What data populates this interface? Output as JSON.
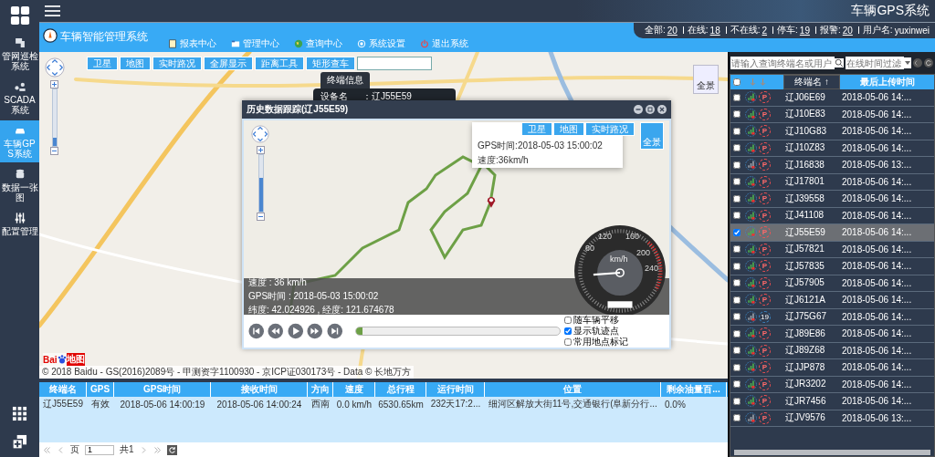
{
  "top_bar": {
    "title": "车辆GPS系统"
  },
  "sidebar": {
    "items": [
      {
        "label": "管网巡检系统",
        "selected": false
      },
      {
        "label": "SCADA系统",
        "selected": false
      },
      {
        "label": "车辆GPS系统",
        "selected": true
      },
      {
        "label": "数据一张图",
        "selected": false
      },
      {
        "label": "配置管理",
        "selected": false
      }
    ]
  },
  "header": {
    "title": "车辆智能管理系统",
    "nav": [
      "报表中心",
      "管理中心",
      "查询中心",
      "系统设置",
      "退出系统"
    ],
    "stats": [
      {
        "label": "全部:",
        "value": "20"
      },
      {
        "label": "在线:",
        "value": "18"
      },
      {
        "label": "不在线:",
        "value": "2"
      },
      {
        "label": "停车:",
        "value": "19"
      },
      {
        "label": "报警:",
        "value": "20"
      }
    ],
    "user_label": "用户名:",
    "user": "yuxinwei"
  },
  "map": {
    "toolbar": [
      "卫星",
      "地图",
      "实时路况",
      "全屏显示",
      "距离工具",
      "矩形查车"
    ],
    "panorama": "全景",
    "zoom": {
      "level": 0.15
    },
    "info_popup": {
      "tab": "终端信息",
      "label": "设备名",
      "value": "：辽J55E59"
    },
    "logo": {
      "left": "Bai",
      "right": "地图"
    },
    "attribution": "© 2018 Baidu - GS(2016)2089号 - 甲测资字1100930 - 京ICP证030173号 - Data © 长地万方"
  },
  "dialog": {
    "title": "历史数据跟踪(辽J55E59)",
    "map_buttons": [
      "卫星",
      "地图",
      "实时路况"
    ],
    "panorama": "全景",
    "zoom": {
      "level": 0.6
    },
    "popup": [
      "GPS时间:2018-05-03 15:00:02",
      "速度:36km/h"
    ],
    "readout": [
      "速度 : 36 km/h",
      "GPS时间 : 2018-05-03 15:00:02",
      "纬度: 42.024926 , 经度: 121.674678"
    ],
    "gauge": {
      "unit": "km/h",
      "ticks": [
        "80",
        "120",
        "160",
        "200",
        "240"
      ]
    },
    "progress": {
      "level": 0.03
    },
    "options": [
      {
        "label": "随车辆平移",
        "checked": false
      },
      {
        "label": "显示轨迹点",
        "checked": true
      },
      {
        "label": "常用地点标记",
        "checked": false
      }
    ]
  },
  "table": {
    "columns": [
      "终端名",
      "GPS",
      "GPS时间",
      "接收时间",
      "方向",
      "速度",
      "总行程",
      "运行时间",
      "位置",
      "剩余油量百..."
    ],
    "rows": [
      [
        "辽J55E59",
        "有效",
        "2018-05-06 14:00:19",
        "2018-05-06 14:00:24",
        "西南",
        "0.0 km/h",
        "6530.65km",
        "232天17:2...",
        "细河区解放大街11号,交通银行(阜新分行...",
        "0.0%"
      ]
    ],
    "pager": {
      "page_label": "页",
      "page": "1",
      "total": "共1"
    }
  },
  "vehicles": {
    "search_placeholder": "请输入查询终端名或用户",
    "filter_placeholder": "在线时间过滤",
    "all_selected": false,
    "columns": [
      "终端名 ↑",
      "最后上传时间"
    ],
    "rows": [
      {
        "name": "辽J06E69",
        "time": "2018-05-06 14:...",
        "online": true,
        "badge": "P",
        "selected": false
      },
      {
        "name": "辽J10E83",
        "time": "2018-05-06 14:...",
        "online": true,
        "badge": "P",
        "selected": false
      },
      {
        "name": "辽J10G83",
        "time": "2018-05-06 14:...",
        "online": true,
        "badge": "P",
        "selected": false
      },
      {
        "name": "辽J10Z83",
        "time": "2018-05-06 14:...",
        "online": true,
        "badge": "P",
        "selected": false
      },
      {
        "name": "辽J16838",
        "time": "2018-05-06 13:...",
        "online": false,
        "badge": "P",
        "selected": false
      },
      {
        "name": "辽J17801",
        "time": "2018-05-06 14:...",
        "online": true,
        "badge": "P",
        "selected": false
      },
      {
        "name": "辽J39558",
        "time": "2018-05-06 14:...",
        "online": true,
        "badge": "P",
        "selected": false
      },
      {
        "name": "辽J41108",
        "time": "2018-05-06 14:...",
        "online": true,
        "badge": "P",
        "selected": false
      },
      {
        "name": "辽J55E59",
        "time": "2018-05-06 14:...",
        "online": true,
        "badge": "P",
        "selected": true
      },
      {
        "name": "辽J57821",
        "time": "2018-05-06 14:...",
        "online": true,
        "badge": "P",
        "selected": false
      },
      {
        "name": "辽J57835",
        "time": "2018-05-06 14:...",
        "online": true,
        "badge": "P",
        "selected": false
      },
      {
        "name": "辽J57905",
        "time": "2018-05-06 14:...",
        "online": true,
        "badge": "P",
        "selected": false
      },
      {
        "name": "辽J6121A",
        "time": "2018-05-06 14:...",
        "online": true,
        "badge": "P",
        "selected": false
      },
      {
        "name": "辽J75G67",
        "time": "2018-05-06 14:...",
        "online": false,
        "badge": "19",
        "selected": false
      },
      {
        "name": "辽J89E86",
        "time": "2018-05-06 14:...",
        "online": true,
        "badge": "P",
        "selected": false
      },
      {
        "name": "辽J89Z68",
        "time": "2018-05-06 14:...",
        "online": true,
        "badge": "P",
        "selected": false
      },
      {
        "name": "辽JJP878",
        "time": "2018-05-06 14:...",
        "online": true,
        "badge": "P",
        "selected": false
      },
      {
        "name": "辽JR3202",
        "time": "2018-05-06 14:...",
        "online": true,
        "badge": "P",
        "selected": false
      },
      {
        "name": "辽JR7456",
        "time": "2018-05-06 14:...",
        "online": true,
        "badge": "P",
        "selected": false
      },
      {
        "name": "辽JV9576",
        "time": "2018-05-06 13:...",
        "online": false,
        "badge": "P",
        "selected": false
      }
    ]
  }
}
